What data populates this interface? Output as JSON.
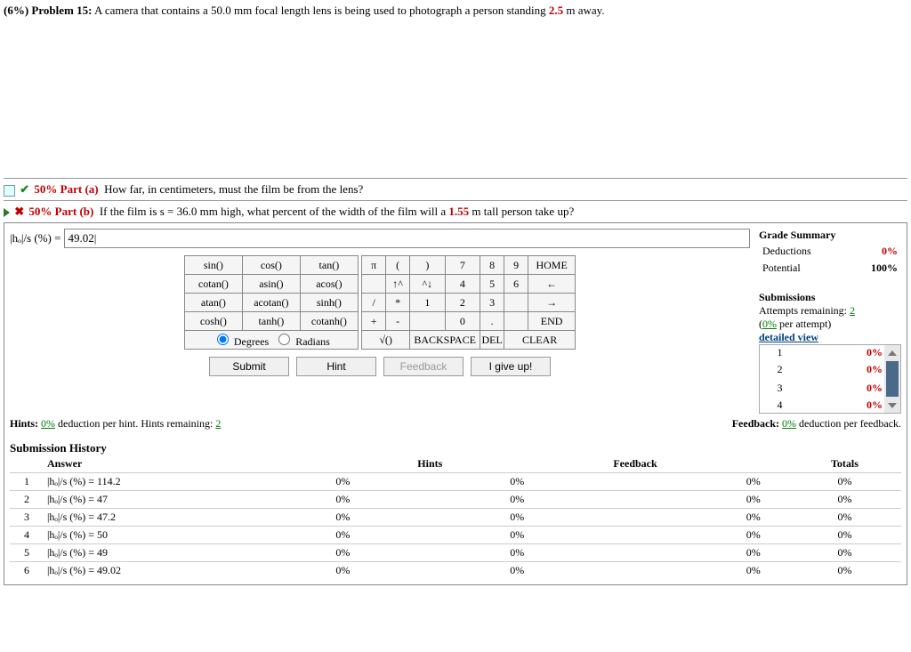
{
  "problem": {
    "weight": "(6%)",
    "label": "Problem 15:",
    "text_before": "A camera that contains a 50.0 mm focal length lens is being used to photograph a person standing ",
    "highlight": "2.5",
    "text_after": " m away."
  },
  "partA": {
    "weight": "50%",
    "label": "Part (a)",
    "text": "How far, in centimeters, must the film be from the lens?"
  },
  "partB": {
    "weight": "50%",
    "label": "Part (b)",
    "text_before": "If the film is s = 36.0 mm high, what percent of the width of the film will a ",
    "highlight": "1.55",
    "text_after": " m tall person take up?"
  },
  "answer": {
    "prefix": "|hₒ|/s (%) = ",
    "value": "49.02|"
  },
  "funcs": {
    "r1": [
      "sin()",
      "cos()",
      "tan()"
    ],
    "r2": [
      "cotan()",
      "asin()",
      "acos()"
    ],
    "r3": [
      "atan()",
      "acotan()",
      "sinh()"
    ],
    "r4": [
      "cosh()",
      "tanh()",
      "cotanh()"
    ],
    "deg": "Degrees",
    "rad": "Radians"
  },
  "nums": {
    "r1": [
      "π",
      "(",
      ")",
      "7",
      "8",
      "9",
      "HOME"
    ],
    "r2": [
      "",
      "↑^",
      "^↓",
      "4",
      "5",
      "6",
      "←"
    ],
    "r3": [
      "/",
      "*",
      "1",
      "2",
      "3",
      "",
      "→"
    ],
    "r4": [
      "+",
      "-",
      "",
      "0",
      ".",
      "",
      "END"
    ],
    "r5": [
      "√()",
      "BACKSPACE",
      "DEL",
      "CLEAR"
    ]
  },
  "buttons": {
    "submit": "Submit",
    "hint": "Hint",
    "feedback": "Feedback",
    "giveup": "I give up!"
  },
  "hints": {
    "left_label": "Hints:",
    "left_val": "0%",
    "left_text": " deduction per hint. Hints remaining: ",
    "left_remain": "2",
    "right_label": "Feedback:",
    "right_val": "0%",
    "right_text": " deduction per feedback."
  },
  "grade": {
    "title": "Grade Summary",
    "deductions_label": "Deductions",
    "deductions_val": "0%",
    "potential_label": "Potential",
    "potential_val": "100%",
    "subs_title": "Submissions",
    "attempts_label": "Attempts remaining: ",
    "attempts_val": "2",
    "per_attempt_a": "(",
    "per_attempt_b": "0%",
    "per_attempt_c": " per attempt)",
    "detailed": "detailed view",
    "rows": [
      {
        "n": "1",
        "v": "0%"
      },
      {
        "n": "2",
        "v": "0%"
      },
      {
        "n": "3",
        "v": "0%"
      },
      {
        "n": "4",
        "v": "0%"
      }
    ]
  },
  "history": {
    "title": "Submission History",
    "cols": {
      "answer": "Answer",
      "hints": "Hints",
      "feedback": "Feedback",
      "totals": "Totals"
    },
    "rows": [
      {
        "n": "1",
        "ans": "|hₒ|/s (%) = 114.2",
        "a": "0%",
        "h": "0%",
        "f": "0%",
        "t": "0%"
      },
      {
        "n": "2",
        "ans": "|hₒ|/s (%) = 47",
        "a": "0%",
        "h": "0%",
        "f": "0%",
        "t": "0%"
      },
      {
        "n": "3",
        "ans": "|hₒ|/s (%) = 47.2",
        "a": "0%",
        "h": "0%",
        "f": "0%",
        "t": "0%"
      },
      {
        "n": "4",
        "ans": "|hₒ|/s (%) = 50",
        "a": "0%",
        "h": "0%",
        "f": "0%",
        "t": "0%"
      },
      {
        "n": "5",
        "ans": "|hₒ|/s (%) = 49",
        "a": "0%",
        "h": "0%",
        "f": "0%",
        "t": "0%"
      },
      {
        "n": "6",
        "ans": "|hₒ|/s (%) = 49.02",
        "a": "0%",
        "h": "0%",
        "f": "0%",
        "t": "0%"
      }
    ]
  }
}
